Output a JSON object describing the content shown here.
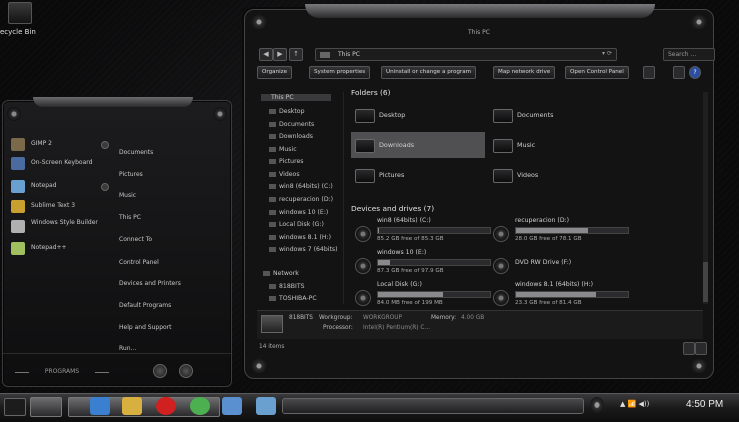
{
  "desktop": {
    "recycle_bin_label": "ecycle Bin"
  },
  "start_menu": {
    "programs": [
      {
        "label": "GIMP 2",
        "icon": "gimp-icon",
        "color": "#7a6a4a",
        "has_arrow": true
      },
      {
        "label": "On-Screen Keyboard",
        "icon": "keyboard-icon",
        "color": "#4a6aa0",
        "has_arrow": false
      },
      {
        "label": "Notepad",
        "icon": "notepad-icon",
        "color": "#6aa0d0",
        "has_arrow": true
      },
      {
        "label": "Sublime Text 3",
        "icon": "sublime-icon",
        "color": "#c8a030",
        "has_arrow": false
      },
      {
        "label": "Windows Style Builder",
        "icon": "style-builder-icon",
        "color": "#b0b0b0",
        "has_arrow": false
      },
      {
        "label": "Notepad++",
        "icon": "notepadpp-icon",
        "color": "#a0c060",
        "has_arrow": false
      }
    ],
    "places": [
      "Documents",
      "Pictures",
      "Music",
      "This PC",
      "Connect To",
      "Control Panel",
      "Devices and Printers",
      "Default Programs",
      "Help and Support",
      "Run..."
    ],
    "programs_button": "PROGRAMS"
  },
  "explorer": {
    "title": "This PC",
    "address": "This PC",
    "search_placeholder": "Search ...",
    "commands": [
      "Organize",
      "System properties",
      "Uninstall or change a program",
      "Map network drive",
      "Open Control Panel"
    ],
    "help_label": "?",
    "nav": {
      "root": "This PC",
      "items": [
        "Desktop",
        "Documents",
        "Downloads",
        "Music",
        "Pictures",
        "Videos",
        "win8 (64bits) (C:)",
        "recuperacion (D:)",
        "windows 10 (E:)",
        "Local Disk (G:)",
        "windows 8.1 (H:)",
        "windows 7 (64bits)"
      ],
      "network": "Network",
      "network_items": [
        "818BITS",
        "TOSHIBA-PC"
      ]
    },
    "folders_header": "Folders (6)",
    "folders": [
      {
        "label": "Desktop",
        "selected": false
      },
      {
        "label": "Documents",
        "selected": false
      },
      {
        "label": "Downloads",
        "selected": true
      },
      {
        "label": "Music",
        "selected": false
      },
      {
        "label": "Pictures",
        "selected": false
      },
      {
        "label": "Videos",
        "selected": false
      }
    ],
    "devices_header": "Devices and drives (7)",
    "drives": [
      {
        "name": "win8 (64bits) (C:)",
        "free": "85.2 GB free of 85.3 GB",
        "used_fraction": 0.01
      },
      {
        "name": "recuperacion (D:)",
        "free": "28.0 GB free of 78.1 GB",
        "used_fraction": 0.64
      },
      {
        "name": "windows 10 (E:)",
        "free": "87.3 GB free of 97.9 GB",
        "used_fraction": 0.11
      },
      {
        "name": "DVD RW Drive (F:)",
        "free": "",
        "used_fraction": 0
      },
      {
        "name": "Local Disk (G:)",
        "free": "84.0 MB free of 199 MB",
        "used_fraction": 0.58
      },
      {
        "name": "windows 8.1 (64bits) (H:)",
        "free": "23.3 GB free of 81.4 GB",
        "used_fraction": 0.71
      }
    ],
    "details": {
      "computer": "818BITS",
      "workgroup_label": "Workgroup:",
      "workgroup": "WORKGROUP",
      "memory_label": "Memory:",
      "memory": "4.00 GB",
      "processor_label": "Processor:",
      "processor": "Intel(R) Pentium(R) C..."
    },
    "item_count": "14 items"
  },
  "taskbar": {
    "apps": [
      {
        "name": "internet-explorer-icon",
        "color": "#3a7fd0"
      },
      {
        "name": "file-explorer-icon",
        "color": "#d8b040"
      },
      {
        "name": "opera-icon",
        "color": "#d02020"
      },
      {
        "name": "chrome-icon",
        "color": "#4caf50"
      },
      {
        "name": "computer-icon",
        "color": "#5a8fd0"
      },
      {
        "name": "notepad-icon",
        "color": "#6aa0d0"
      }
    ],
    "tray": "▲ 📶 ◀))",
    "clock": "4:50 PM"
  }
}
